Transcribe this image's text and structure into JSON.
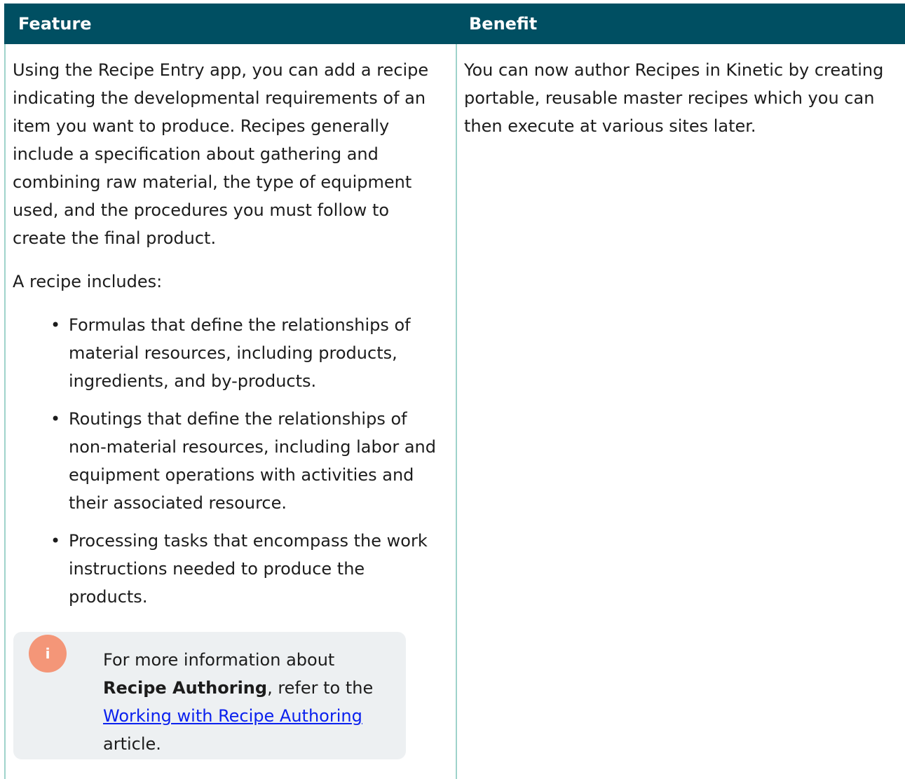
{
  "table": {
    "headers": {
      "feature": "Feature",
      "benefit": "Benefit"
    },
    "row": {
      "feature": {
        "intro": "Using the Recipe Entry app, you can add a recipe indicating the developmental requirements of an item you want to produce. Recipes generally include a specification about gathering and combining raw material, the type of equipment used, and the procedures you must follow to create the final product.",
        "includes_label": "A recipe includes:",
        "bullets": [
          "Formulas that define the relationships of material resources, including products, ingredients, and by-products.",
          "Routings that define the relationships of non-material resources, including labor and equipment operations with activities and their associated resource.",
          "Processing tasks that encompass the work instructions needed to produce the products."
        ],
        "note": {
          "icon": "info-icon",
          "icon_glyph": "i",
          "text_before": "For more information about ",
          "bold": "Recipe Authoring",
          "text_middle": ", refer to the ",
          "link_text": "Working with Recipe Authoring",
          "text_after": " article."
        }
      },
      "benefit": {
        "text": "You can now author Recipes in Kinetic by creating portable, reusable master recipes which you can then execute at various sites later."
      }
    }
  },
  "colors": {
    "header_bg": "#004f62",
    "border": "#9fd3cb",
    "note_bg": "#edf0f2",
    "note_icon": "#f49678",
    "link": "#0b21ee"
  }
}
